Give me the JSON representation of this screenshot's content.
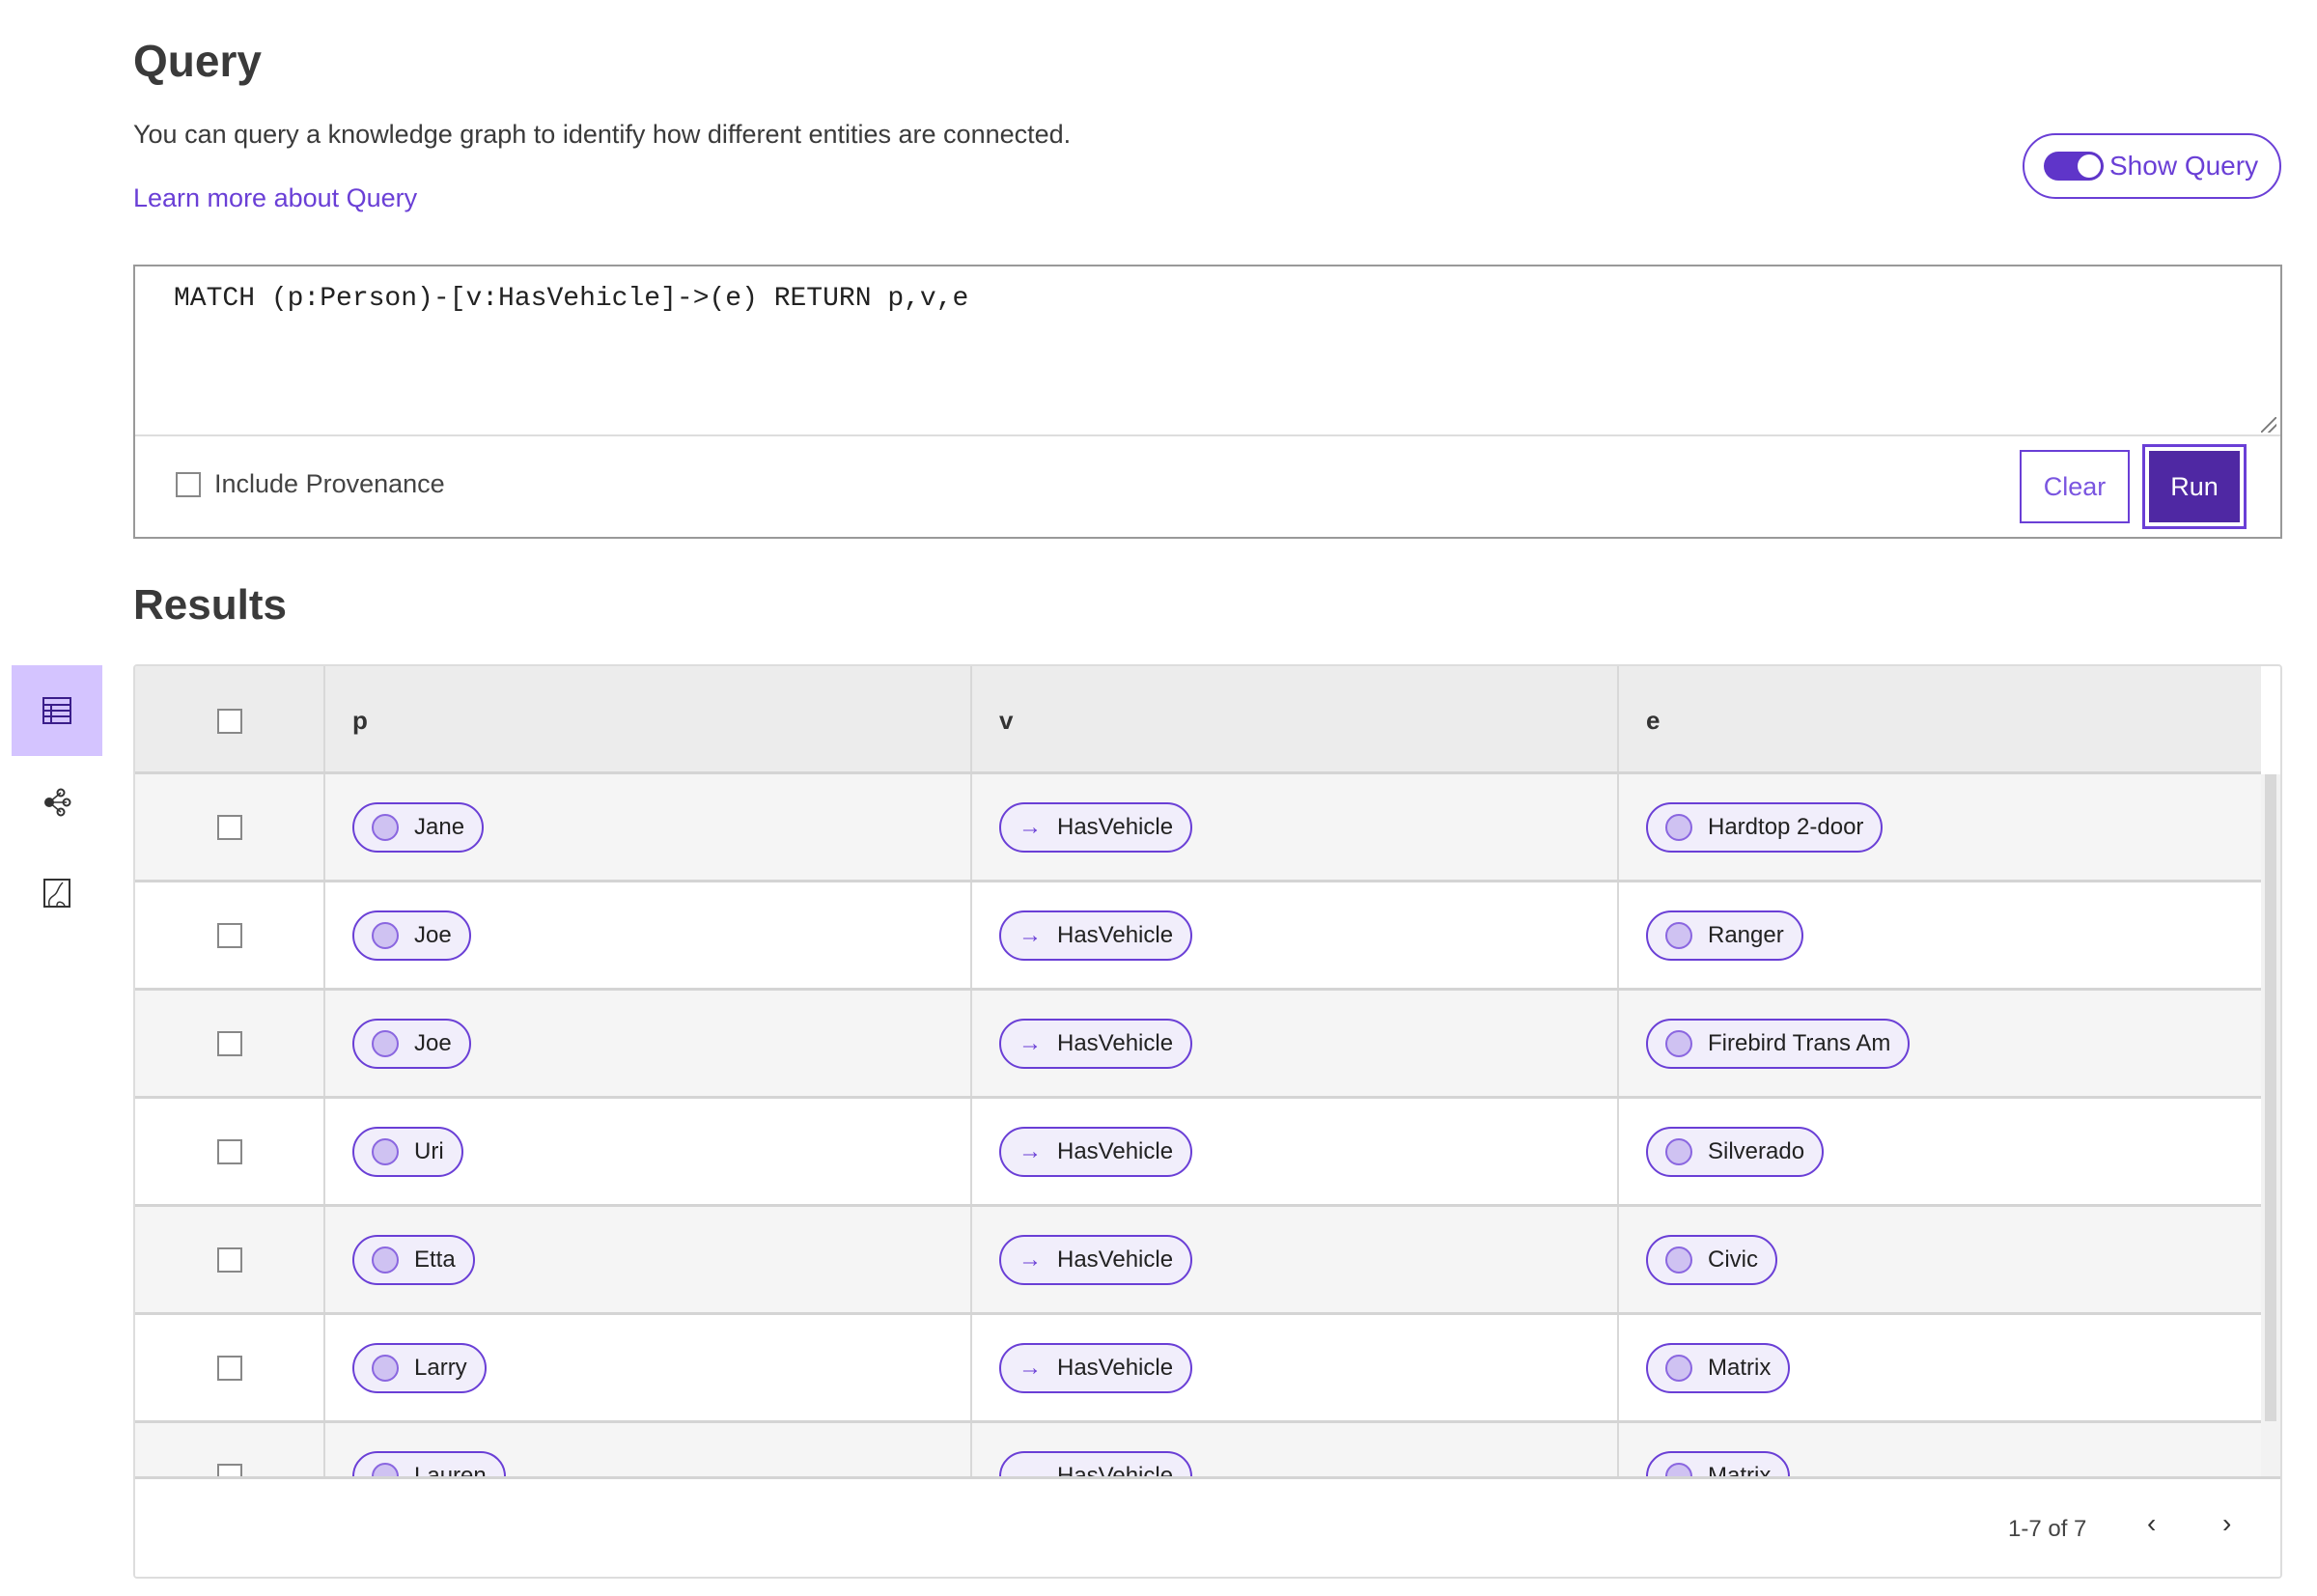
{
  "header": {
    "title": "Query",
    "description": "You can query a knowledge graph to identify how different entities are connected.",
    "learn_more": "Learn more about Query",
    "show_query_label": "Show Query",
    "show_query_on": true
  },
  "query": {
    "text": "MATCH (p:Person)-[v:HasVehicle]->(e) RETURN p,v,e",
    "include_provenance_label": "Include Provenance",
    "include_provenance_checked": false,
    "clear_label": "Clear",
    "run_label": "Run"
  },
  "sidebar": {
    "items": [
      {
        "icon": "table-icon",
        "active": true
      },
      {
        "icon": "graph-icon",
        "active": false
      },
      {
        "icon": "map-icon",
        "active": false
      }
    ]
  },
  "results": {
    "title": "Results",
    "columns": [
      "p",
      "v",
      "e"
    ],
    "rows": [
      {
        "p": "Jane",
        "v": "HasVehicle",
        "e": "Hardtop 2-door"
      },
      {
        "p": "Joe",
        "v": "HasVehicle",
        "e": "Ranger"
      },
      {
        "p": "Joe",
        "v": "HasVehicle",
        "e": "Firebird Trans Am"
      },
      {
        "p": "Uri",
        "v": "HasVehicle",
        "e": "Silverado"
      },
      {
        "p": "Etta",
        "v": "HasVehicle",
        "e": "Civic"
      },
      {
        "p": "Larry",
        "v": "HasVehicle",
        "e": "Matrix"
      },
      {
        "p": "Lauren",
        "v": "HasVehicle",
        "e": "Matrix"
      }
    ],
    "pagination": "1-7 of 7"
  },
  "colors": {
    "accent": "#6a3fd6",
    "run_bg": "#4f28a3",
    "active_sidebar": "#d4c4ff"
  }
}
